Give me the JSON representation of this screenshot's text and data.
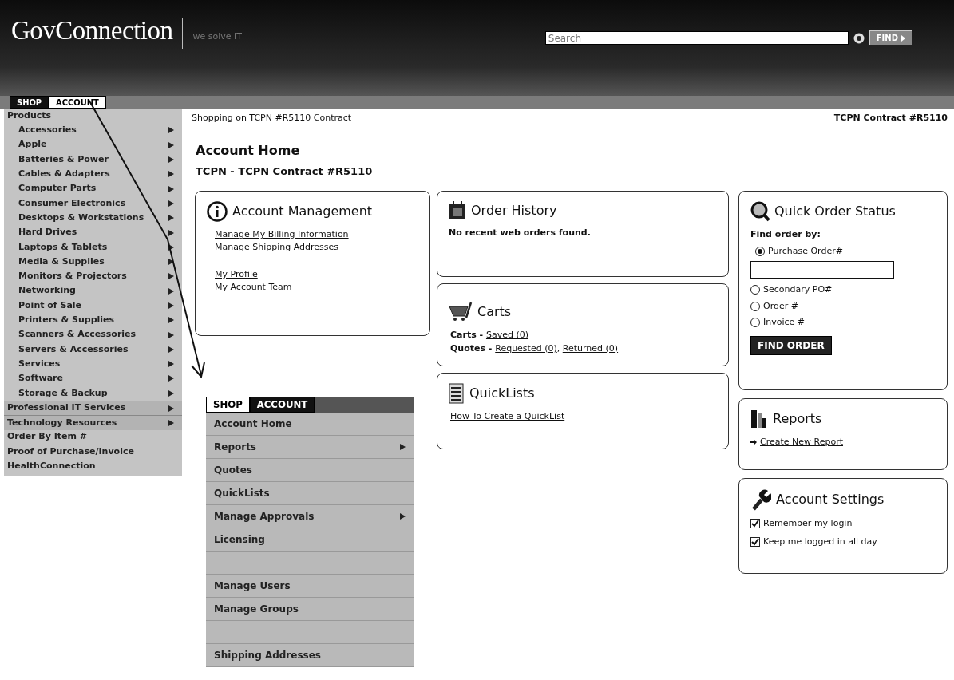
{
  "header": {
    "logo": "GovConnection",
    "tagline": "we solve IT",
    "search": {
      "placeholder": "Search"
    },
    "find_button": "FIND"
  },
  "tabs": [
    {
      "label": "SHOP",
      "selected": true
    },
    {
      "label": "ACCOUNT",
      "selected": false
    }
  ],
  "sidebar": {
    "items": [
      {
        "label": "Products",
        "submenu": false,
        "children": [
          {
            "label": "Accessories",
            "submenu": true
          },
          {
            "label": "Apple",
            "submenu": true
          },
          {
            "label": "Batteries & Power",
            "submenu": true
          },
          {
            "label": "Cables & Adapters",
            "submenu": true
          },
          {
            "label": "Computer Parts",
            "submenu": true
          },
          {
            "label": "Consumer Electronics",
            "submenu": true
          },
          {
            "label": "Desktops & Workstations",
            "submenu": true
          },
          {
            "label": "Hard Drives",
            "submenu": true
          },
          {
            "label": "Laptops & Tablets",
            "submenu": true
          },
          {
            "label": "Media & Supplies",
            "submenu": true
          },
          {
            "label": "Monitors & Projectors",
            "submenu": true
          },
          {
            "label": "Networking",
            "submenu": true
          },
          {
            "label": "Point of Sale",
            "submenu": true
          },
          {
            "label": "Printers & Supplies",
            "submenu": true
          },
          {
            "label": "Scanners & Accessories",
            "submenu": true
          },
          {
            "label": "Servers & Accessories",
            "submenu": true
          },
          {
            "label": "Services",
            "submenu": true
          },
          {
            "label": "Software",
            "submenu": true
          },
          {
            "label": "Storage & Backup",
            "submenu": true
          }
        ]
      },
      {
        "label": "Professional IT Services",
        "submenu": true
      },
      {
        "label": "Technology Resources",
        "submenu": true
      },
      {
        "label": "Order By Item #",
        "submenu": false
      },
      {
        "label": "Proof of Purchase/Invoice",
        "submenu": false
      },
      {
        "label": "HealthConnection",
        "submenu": false
      }
    ]
  },
  "breadcrumb": "Shopping on TCPN #R5110 Contract",
  "contract": "TCPN Contract #R5110",
  "page_title": "Account Home",
  "subtitle": "TCPN - TCPN Contract #R5110",
  "account_management": {
    "title": "Account Management",
    "link_groups": [
      [
        "Manage My Billing Information",
        "Manage Shipping Addresses"
      ],
      [
        "My Profile",
        "My Account Team"
      ]
    ]
  },
  "account_menu": {
    "tabs": [
      {
        "label": "SHOP",
        "selected": false
      },
      {
        "label": "ACCOUNT",
        "selected": true
      }
    ],
    "items": [
      {
        "kind": "item",
        "label": "Account Home",
        "submenu": false
      },
      {
        "kind": "item",
        "label": "Reports",
        "submenu": true
      },
      {
        "kind": "item",
        "label": "Quotes",
        "submenu": false
      },
      {
        "kind": "item",
        "label": "QuickLists",
        "submenu": false
      },
      {
        "kind": "item",
        "label": "Manage Approvals",
        "submenu": true
      },
      {
        "kind": "item",
        "label": "Licensing",
        "submenu": false
      },
      {
        "kind": "blank"
      },
      {
        "kind": "item",
        "label": "Manage Users",
        "submenu": false
      },
      {
        "kind": "item",
        "label": "Manage Groups",
        "submenu": false
      },
      {
        "kind": "blank"
      },
      {
        "kind": "item",
        "label": "Shipping Addresses",
        "submenu": false
      }
    ]
  },
  "order_history": {
    "title": "Order History",
    "message": "No recent web orders found."
  },
  "carts": {
    "title": "Carts",
    "lines": [
      {
        "label": "Carts - ",
        "links": [
          "Saved (0)"
        ]
      },
      {
        "label": "Quotes - ",
        "links": [
          "Requested (0)",
          "Returned (0)"
        ],
        "separator": ", "
      }
    ]
  },
  "quicklists": {
    "title": "QuickLists",
    "link": "How To Create a QuickList"
  },
  "quick_order_status": {
    "title": "Quick Order Status",
    "prompt": "Find order by:",
    "options": [
      {
        "label": "Purchase Order#",
        "selected": true
      },
      {
        "label": "Secondary PO#",
        "selected": false
      },
      {
        "label": "Order #",
        "selected": false
      },
      {
        "label": "Invoice #",
        "selected": false
      }
    ],
    "button": "FIND ORDER"
  },
  "reports": {
    "title": "Reports",
    "link": "Create New Report"
  },
  "account_settings": {
    "title": "Account Settings",
    "options": [
      {
        "label": "Remember my login",
        "checked": true
      },
      {
        "label": "Keep me logged in all day",
        "checked": true
      }
    ]
  }
}
